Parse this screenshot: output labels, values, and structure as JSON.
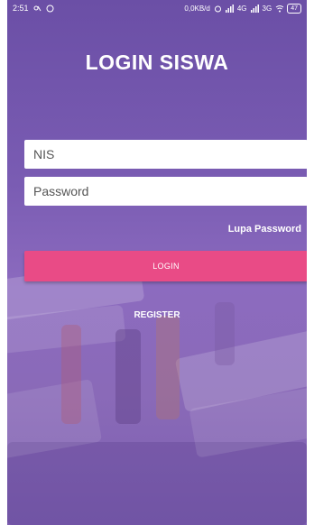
{
  "status_bar": {
    "time": "2:51",
    "network_speed": "0,0KB/d",
    "network_4g": "4G",
    "network_3g": "3G",
    "battery": "47",
    "icons": [
      "notification-icon",
      "whatsapp-icon",
      "alarm-icon",
      "signal-icon",
      "wifi-icon",
      "battery-icon"
    ]
  },
  "header": {
    "title": "LOGIN SISWA"
  },
  "form": {
    "nis_placeholder": "NIS",
    "password_placeholder": "Password",
    "forgot_label": "Lupa Password",
    "login_label": "LOGIN",
    "register_label": "REGISTER"
  },
  "colors": {
    "background": "#7a5cb3",
    "login_button": "#e94b86",
    "text": "#ffffff"
  }
}
